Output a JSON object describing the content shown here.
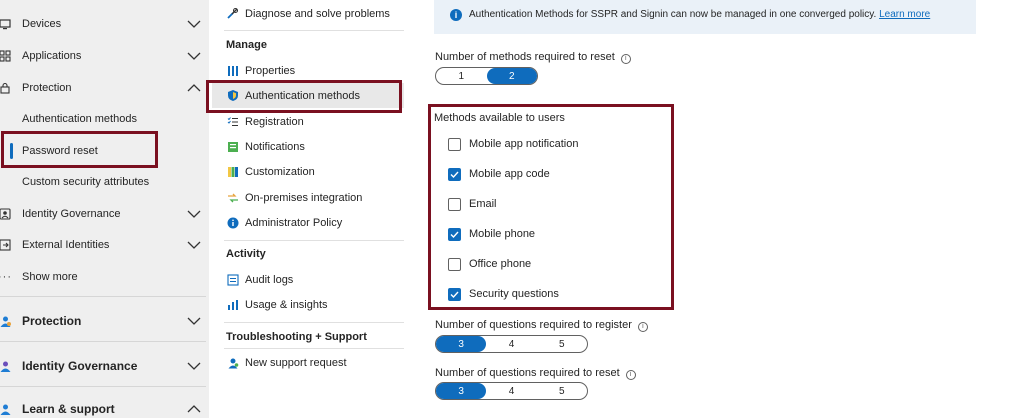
{
  "colors": {
    "accent": "#0f6cbd",
    "highlight_box": "#7a1020",
    "nav_bg": "#efefef"
  },
  "left_nav": {
    "items": [
      {
        "label": "Devices",
        "icon": "devices-icon",
        "expanded": false
      },
      {
        "label": "Applications",
        "icon": "applications-icon",
        "expanded": false
      },
      {
        "label": "Protection",
        "icon": "lock-icon",
        "expanded": true
      }
    ],
    "protection_children": [
      {
        "label": "Authentication methods"
      },
      {
        "label": "Password reset",
        "active": true
      },
      {
        "label": "Custom security attributes"
      }
    ],
    "more_items": [
      {
        "label": "Identity Governance",
        "icon": "identity-governance-icon"
      },
      {
        "label": "External Identities",
        "icon": "external-identities-icon"
      },
      {
        "label": "Show more",
        "icon": "more-icon"
      }
    ],
    "sections": [
      {
        "label": "Protection",
        "icon": "protection-icon"
      },
      {
        "label": "Identity Governance",
        "icon": "identity-governance-icon"
      },
      {
        "label": "Learn & support",
        "icon": "learn-icon"
      }
    ]
  },
  "mid_menu": {
    "top_item": {
      "label": "Diagnose and solve problems",
      "icon": "wrench-icon"
    },
    "manage_heading": "Manage",
    "manage_items": [
      {
        "label": "Properties",
        "icon": "properties-icon"
      },
      {
        "label": "Authentication methods",
        "icon": "shield-icon",
        "selected": true
      },
      {
        "label": "Registration",
        "icon": "registration-icon"
      },
      {
        "label": "Notifications",
        "icon": "notifications-icon"
      },
      {
        "label": "Customization",
        "icon": "customization-icon"
      },
      {
        "label": "On-premises integration",
        "icon": "integration-icon"
      },
      {
        "label": "Administrator Policy",
        "icon": "info-icon"
      }
    ],
    "activity_heading": "Activity",
    "activity_items": [
      {
        "label": "Audit logs",
        "icon": "audit-logs-icon"
      },
      {
        "label": "Usage & insights",
        "icon": "usage-icon"
      }
    ],
    "support_heading": "Troubleshooting + Support",
    "support_items": [
      {
        "label": "New support request",
        "icon": "support-icon"
      }
    ]
  },
  "content": {
    "banner": {
      "text": "Authentication Methods for SSPR and Signin can now be managed in one converged policy.",
      "link": "Learn more"
    },
    "methods_required": {
      "label": "Number of methods required to reset",
      "options": [
        "1",
        "2"
      ],
      "selected": "2"
    },
    "methods_available": {
      "title": "Methods available to users",
      "items": [
        {
          "label": "Mobile app notification",
          "checked": false
        },
        {
          "label": "Mobile app code",
          "checked": true
        },
        {
          "label": "Email",
          "checked": false
        },
        {
          "label": "Mobile phone",
          "checked": true
        },
        {
          "label": "Office phone",
          "checked": false
        },
        {
          "label": "Security questions",
          "checked": true
        }
      ]
    },
    "questions_register": {
      "label": "Number of questions required to register",
      "options": [
        "3",
        "4",
        "5"
      ],
      "selected": "3"
    },
    "questions_reset": {
      "label": "Number of questions required to reset",
      "options": [
        "3",
        "4",
        "5"
      ],
      "selected": "3"
    }
  }
}
